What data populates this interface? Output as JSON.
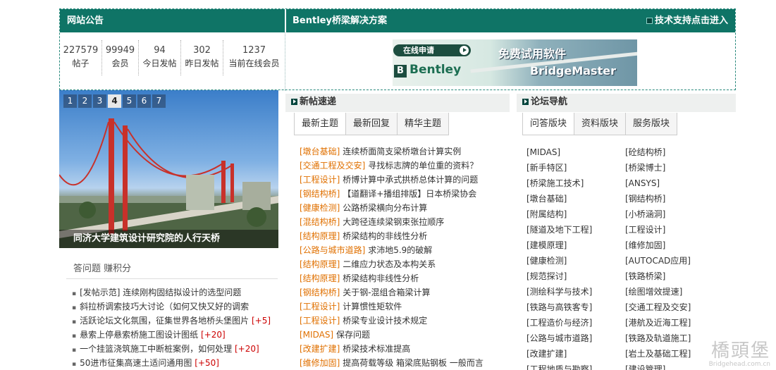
{
  "top": {
    "announce_title": "网站公告",
    "solution_title": "Bentley桥梁解决方案",
    "tech_link": "技术支持点击进入",
    "stats": [
      {
        "num": "227579",
        "label": "帖子"
      },
      {
        "num": "99949",
        "label": "会员"
      },
      {
        "num": "94",
        "label": "今日发帖"
      },
      {
        "num": "302",
        "label": "昨日发帖"
      },
      {
        "num": "1237",
        "label": "当前在线会员"
      }
    ],
    "banner": {
      "apply": "在线申请",
      "free": "免费试用软件",
      "product": "BridgeMaster",
      "brand": "Bentley"
    }
  },
  "slider": {
    "pages": [
      "1",
      "2",
      "3",
      "4",
      "5",
      "6",
      "7"
    ],
    "active": "4",
    "caption": "同济大学建筑设计研究院的人行天桥"
  },
  "qa": {
    "title": "答问题 赚积分",
    "items": [
      {
        "text": "[发帖示范] 连续刚构固结拟设计的选型问题",
        "extra": ""
      },
      {
        "text": "斜拉桥调索技巧大讨论（如何又快又好的调索",
        "extra": ""
      },
      {
        "text": "活跃论坛文化氛围，征集世界各地桥头堡图片",
        "extra": "[+5]"
      },
      {
        "text": "悬索上停悬索桥施工图设计图纸",
        "extra": "[+20]"
      },
      {
        "text": "一个挂篮浇筑施工中断桩案例，如何处理",
        "extra": "[+20]"
      },
      {
        "text": "50进市征集高速土适问通用图",
        "extra": "[+50]"
      }
    ]
  },
  "newposts": {
    "title": "新帖速递",
    "tabs": [
      "最新主题",
      "最新回复",
      "精华主题"
    ],
    "items": [
      {
        "cat": "[墩台基础]",
        "title": "连续桥面简支梁桥墩台计算实例"
      },
      {
        "cat": "[交通工程及交安]",
        "title": "寻找标志牌的单位重的资料？"
      },
      {
        "cat": "[工程设计]",
        "title": "桥博计算中承式拱桥总体计算的问题"
      },
      {
        "cat": "[钢结构桥]",
        "title": "【道翻译+播组排版】日本桥梁协会"
      },
      {
        "cat": "[健康检测]",
        "title": "公路桥梁横向分布计算"
      },
      {
        "cat": "[混结构桥]",
        "title": "大跨径连续梁钢束张拉顺序"
      },
      {
        "cat": "[结构原理]",
        "title": "桥梁结构的非线性分析"
      },
      {
        "cat": "[公路与城市道路]",
        "title": "求沛地5.9的破解"
      },
      {
        "cat": "[结构原理]",
        "title": "二维应力状态及本构关系"
      },
      {
        "cat": "[结构原理]",
        "title": "桥梁结构非线性分析"
      },
      {
        "cat": "[钢结构桥]",
        "title": "关于钢-混组合箱梁计算"
      },
      {
        "cat": "[工程设计]",
        "title": "计算惯性矩软件"
      },
      {
        "cat": "[工程设计]",
        "title": "桥梁专业设计技术规定"
      },
      {
        "cat": "[MIDAS]",
        "title": "保存问题"
      },
      {
        "cat": "[改建扩建]",
        "title": "桥梁技术标准提高"
      },
      {
        "cat": "[维修加固]",
        "title": "提高荷载等级 箱梁底贴钢板 一般而言"
      }
    ]
  },
  "forums": {
    "title": "论坛导航",
    "tabs": [
      "问答版块",
      "资料版块",
      "服务版块"
    ],
    "items": [
      "[MIDAS]",
      "[砼结构桥]",
      "[新手特区]",
      "[桥梁博士]",
      "[桥梁施工技术]",
      "[ANSYS]",
      "[墩台基础]",
      "[钢结构桥]",
      "[附属结构]",
      "[小桥涵洞]",
      "[隧道及地下工程]",
      "[工程设计]",
      "[建模原理]",
      "[维修加固]",
      "[健康检测]",
      "[AUTOCAD应用]",
      "[规范探讨]",
      "[铁路桥梁]",
      "[测绘科学与技术]",
      "[绘图增效提速]",
      "[铁路与高铁客专]",
      "[交通工程及交安]",
      "[工程造价与经济]",
      "[港航及近海工程]",
      "[公路与城市道路]",
      "[铁路及轨道施工]",
      "[改建扩建]",
      "[岩土及基础工程]",
      "[工程地质与勘察]",
      "[建设管理]"
    ]
  },
  "watermark": {
    "cn": "橋頭堡",
    "en": "Bridgehead.com.cn"
  }
}
